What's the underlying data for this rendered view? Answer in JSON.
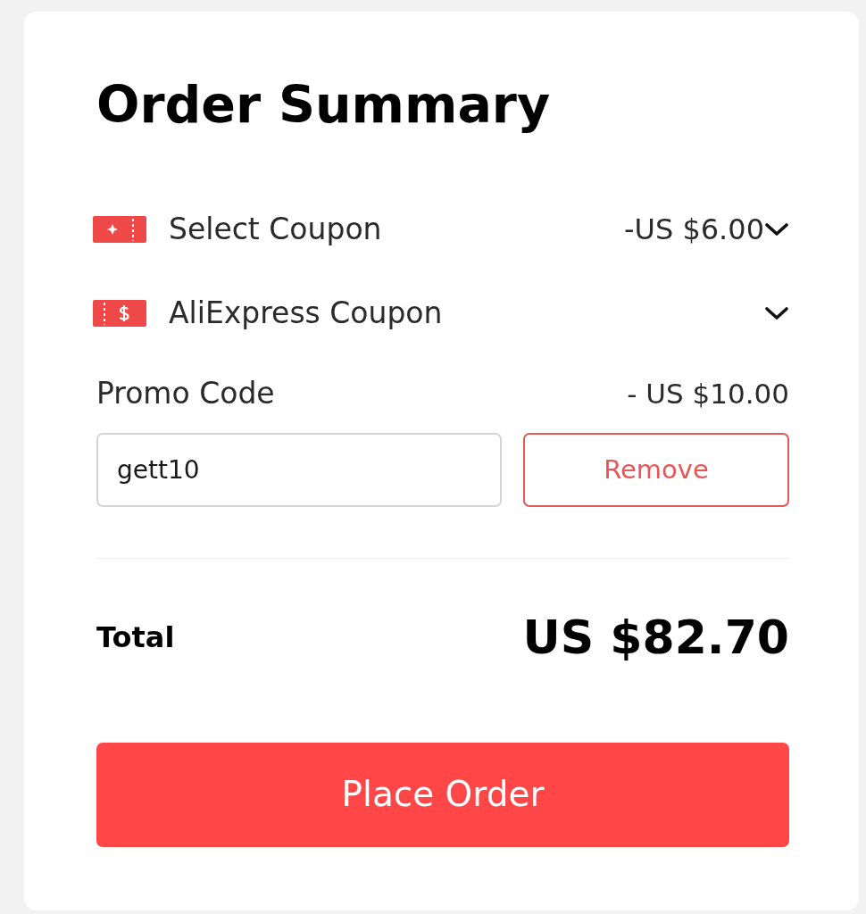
{
  "title": "Order Summary",
  "coupons": [
    {
      "kind": "store",
      "label": "Select Coupon",
      "amount": "-US $6.00"
    },
    {
      "kind": "platform",
      "label": "AliExpress Coupon"
    }
  ],
  "promo": {
    "label": "Promo Code",
    "amount": "- US $10.00",
    "value": "gett10",
    "button": "Remove"
  },
  "total": {
    "label": "Total",
    "amount": "US $82.70"
  },
  "place_order": "Place Order"
}
